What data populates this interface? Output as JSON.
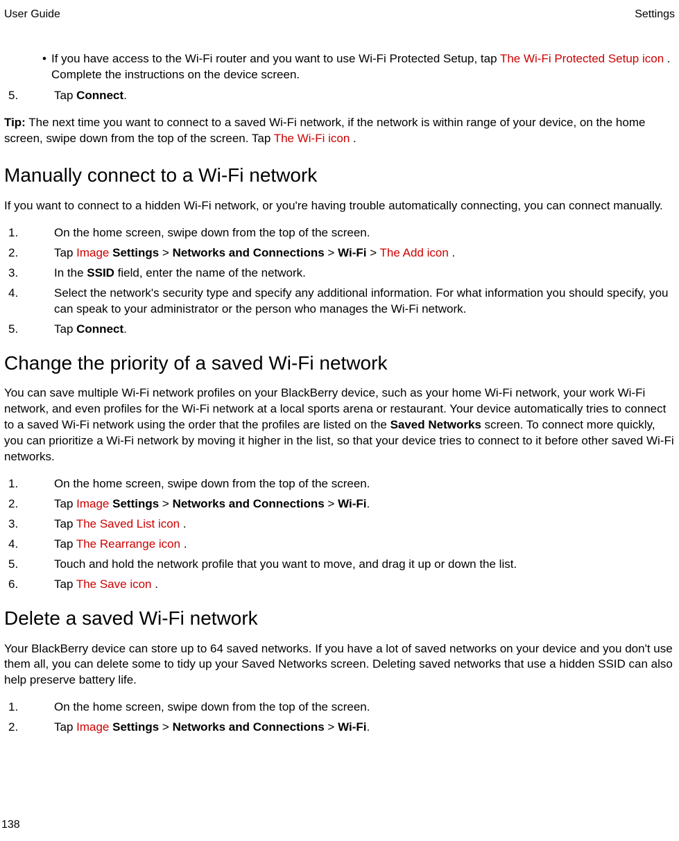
{
  "header": {
    "left": "User Guide",
    "right": "Settings"
  },
  "page_number": "138",
  "intro_bullet": {
    "pre": "If you have access to the Wi-Fi router and you want to use Wi-Fi Protected Setup, tap ",
    "red": " The Wi-Fi Protected Setup icon ",
    "post": ". Complete the instructions on the device screen."
  },
  "step5_top": {
    "num": "5.",
    "pre": "Tap ",
    "bold": "Connect",
    "post": "."
  },
  "tip": {
    "label": "Tip:",
    "pre": " The next time you want to connect to a saved Wi-Fi network, if the network is within range of your device, on the home screen, swipe down from the top of the screen. Tap ",
    "red": " The Wi-Fi icon ",
    "post": "."
  },
  "manual": {
    "heading": "Manually connect to a Wi-Fi network",
    "intro": "If you want to connect to a hidden Wi-Fi network, or you're having trouble automatically connecting, you can connect manually.",
    "steps": {
      "s1": {
        "num": "1.",
        "text": "On the home screen, swipe down from the top of the screen."
      },
      "s2": {
        "num": "2.",
        "pre": "Tap ",
        "img": " Image ",
        "bold1": " Settings",
        "sep1": " > ",
        "bold2": "Networks and Connections",
        "sep2": " > ",
        "bold3": "Wi-Fi",
        "sep3": " > ",
        "red": " The Add icon ",
        "post": "."
      },
      "s3": {
        "num": "3.",
        "pre": "In the ",
        "bold": "SSID",
        "post": " field, enter the name of the network."
      },
      "s4": {
        "num": "4.",
        "text": "Select the network's security type and specify any additional information. For what information you should specify, you can speak to your administrator or the person who manages the Wi-Fi network."
      },
      "s5": {
        "num": "5.",
        "pre": "Tap ",
        "bold": "Connect",
        "post": "."
      }
    }
  },
  "priority": {
    "heading": "Change the priority of a saved Wi-Fi network",
    "intro_pre": "You can save multiple Wi-Fi network profiles on your BlackBerry device, such as your home Wi-Fi network, your work Wi-Fi network, and even profiles for the Wi-Fi network at a local sports arena or restaurant. Your device automatically tries to connect to a saved Wi-Fi network using the order that the profiles are listed on the ",
    "intro_bold": "Saved Networks",
    "intro_post": " screen. To connect more quickly, you can prioritize a Wi-Fi network by moving it higher in the list, so that your device tries to connect to it before other saved Wi-Fi networks.",
    "steps": {
      "s1": {
        "num": "1.",
        "text": "On the home screen, swipe down from the top of the screen."
      },
      "s2": {
        "num": "2.",
        "pre": "Tap ",
        "img": " Image ",
        "bold1": " Settings",
        "sep1": " > ",
        "bold2": "Networks and Connections",
        "sep2": " > ",
        "bold3": "Wi-Fi",
        "post": "."
      },
      "s3": {
        "num": "3.",
        "pre": "Tap ",
        "red": " The Saved List icon ",
        "post": "."
      },
      "s4": {
        "num": "4.",
        "pre": "Tap ",
        "red": " The Rearrange icon ",
        "post": "."
      },
      "s5": {
        "num": "5.",
        "text": "Touch and hold the network profile that you want to move, and drag it up or down the list."
      },
      "s6": {
        "num": "6.",
        "pre": "Tap ",
        "red": " The Save icon ",
        "post": "."
      }
    }
  },
  "delete": {
    "heading": "Delete a saved Wi-Fi network",
    "intro": "Your BlackBerry device can store up to 64 saved networks. If you have a lot of saved networks on your device and you don't use them all, you can delete some to tidy up your Saved Networks screen. Deleting saved networks that use a hidden SSID can also help preserve battery life.",
    "steps": {
      "s1": {
        "num": "1.",
        "text": "On the home screen, swipe down from the top of the screen."
      },
      "s2": {
        "num": "2.",
        "pre": "Tap ",
        "img": " Image ",
        "bold1": " Settings",
        "sep1": " > ",
        "bold2": "Networks and Connections",
        "sep2": " > ",
        "bold3": "Wi-Fi",
        "post": "."
      }
    }
  }
}
